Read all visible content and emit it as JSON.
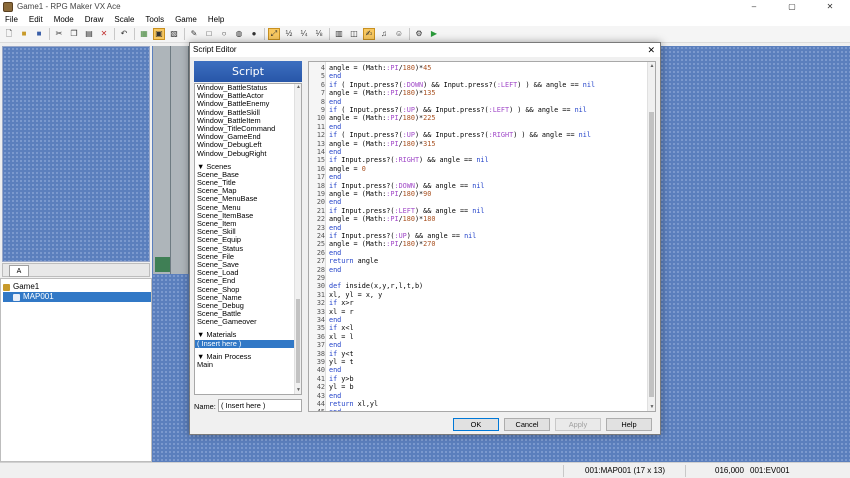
{
  "window": {
    "title": "Game1 - RPG Maker VX Ace",
    "minimize": "–",
    "maximize": "▢",
    "close": "✕"
  },
  "menu": [
    "File",
    "Edit",
    "Mode",
    "Draw",
    "Scale",
    "Tools",
    "Game",
    "Help"
  ],
  "toolbar": {
    "groupA": [
      "new-icon",
      "open-icon",
      "save-icon",
      "cut-icon",
      "copy-icon",
      "paste-icon",
      "delete-icon"
    ],
    "groupB": [
      "undo-icon"
    ],
    "groupC": [
      "map-layer-icon",
      "event-layer-icon",
      "region-icon"
    ],
    "groupD": [
      "pencil-icon",
      "rectangle-icon",
      "ellipse-icon",
      "fill-icon",
      "shadow-pen-icon"
    ],
    "groupE": [
      "scale-1-1-icon",
      "scale-1-2-icon",
      "scale-1-4-icon",
      "scale-1-8-icon"
    ],
    "groupF": [
      "database-icon",
      "resource-manager-icon",
      "script-editor-icon",
      "sound-test-icon",
      "character-generator-icon"
    ],
    "groupG": [
      "search-icon",
      "playtest-icon"
    ],
    "scale_labels": [
      "½",
      "¼",
      "⅛"
    ]
  },
  "tileset": {
    "tab": "A"
  },
  "map_tree": {
    "project": "Game1",
    "maps": [
      "MAP001"
    ],
    "selected": "MAP001"
  },
  "status": {
    "map": "001:MAP001 (17 x 13)",
    "coords": "016,000",
    "event": "001:EV001"
  },
  "dialog": {
    "title": "Script Editor",
    "close": "✕",
    "header": "Script",
    "list": [
      {
        "text": "Window_BattleStatus"
      },
      {
        "text": "Window_BattleActor"
      },
      {
        "text": "Window_BattleEnemy"
      },
      {
        "text": "Window_BattleSkill"
      },
      {
        "text": "Window_BattleItem"
      },
      {
        "text": "Window_TitleCommand"
      },
      {
        "text": "Window_GameEnd"
      },
      {
        "text": "Window_DebugLeft"
      },
      {
        "text": "Window_DebugRight"
      },
      {
        "gap": true
      },
      {
        "text": "▼ Scenes",
        "section": true
      },
      {
        "text": "Scene_Base"
      },
      {
        "text": "Scene_Title"
      },
      {
        "text": "Scene_Map"
      },
      {
        "text": "Scene_MenuBase"
      },
      {
        "text": "Scene_Menu"
      },
      {
        "text": "Scene_ItemBase"
      },
      {
        "text": "Scene_Item"
      },
      {
        "text": "Scene_Skill"
      },
      {
        "text": "Scene_Equip"
      },
      {
        "text": "Scene_Status"
      },
      {
        "text": "Scene_File"
      },
      {
        "text": "Scene_Save"
      },
      {
        "text": "Scene_Load"
      },
      {
        "text": "Scene_End"
      },
      {
        "text": "Scene_Shop"
      },
      {
        "text": "Scene_Name"
      },
      {
        "text": "Scene_Debug"
      },
      {
        "text": "Scene_Battle"
      },
      {
        "text": "Scene_Gameover"
      },
      {
        "gap": true
      },
      {
        "text": "▼ Materials",
        "section": true
      },
      {
        "text": "( Insert here )",
        "selected": true
      },
      {
        "gap": true
      },
      {
        "text": "▼ Main Process",
        "section": true
      },
      {
        "text": "Main"
      }
    ],
    "name_label": "Name:",
    "name_value": "( Insert here )",
    "code": [
      {
        "n": "4",
        "t": "angle = (Math::PI/180)*45"
      },
      {
        "n": "5",
        "t": "end"
      },
      {
        "n": "6",
        "t": "if ( Input.press?(:DOWN) && Input.press?(:LEFT) ) && angle == nil"
      },
      {
        "n": "7",
        "t": "angle = (Math::PI/180)*135"
      },
      {
        "n": "8",
        "t": "end"
      },
      {
        "n": "9",
        "t": "if ( Input.press?(:UP) && Input.press?(:LEFT) ) && angle == nil"
      },
      {
        "n": "10",
        "t": "angle = (Math::PI/180)*225"
      },
      {
        "n": "11",
        "t": "end"
      },
      {
        "n": "12",
        "t": "if ( Input.press?(:UP) && Input.press?(:RIGHT) ) && angle == nil"
      },
      {
        "n": "13",
        "t": "angle = (Math::PI/180)*315"
      },
      {
        "n": "14",
        "t": "end"
      },
      {
        "n": "15",
        "t": "if Input.press?(:RIGHT) && angle == nil"
      },
      {
        "n": "16",
        "t": "angle = 0"
      },
      {
        "n": "17",
        "t": "end"
      },
      {
        "n": "18",
        "t": "if Input.press?(:DOWN) && angle == nil"
      },
      {
        "n": "19",
        "t": "angle = (Math::PI/180)*90"
      },
      {
        "n": "20",
        "t": "end"
      },
      {
        "n": "21",
        "t": "if Input.press?(:LEFT) && angle == nil"
      },
      {
        "n": "22",
        "t": "angle = (Math::PI/180)*180"
      },
      {
        "n": "23",
        "t": "end"
      },
      {
        "n": "24",
        "t": "if Input.press?(:UP) && angle == nil"
      },
      {
        "n": "25",
        "t": "angle = (Math::PI/180)*270"
      },
      {
        "n": "26",
        "t": "end"
      },
      {
        "n": "27",
        "t": "return angle"
      },
      {
        "n": "28",
        "t": "end"
      },
      {
        "n": "29",
        "t": ""
      },
      {
        "n": "30",
        "t": "def inside(x,y,r,l,t,b)"
      },
      {
        "n": "31",
        "t": "xl, yl = x, y"
      },
      {
        "n": "32",
        "t": "if x>r"
      },
      {
        "n": "33",
        "t": "xl = r"
      },
      {
        "n": "34",
        "t": "end"
      },
      {
        "n": "35",
        "t": "if x<l"
      },
      {
        "n": "36",
        "t": "xl = l"
      },
      {
        "n": "37",
        "t": "end"
      },
      {
        "n": "38",
        "t": "if y<t"
      },
      {
        "n": "39",
        "t": "yl = t"
      },
      {
        "n": "40",
        "t": "end"
      },
      {
        "n": "41",
        "t": "if y>b"
      },
      {
        "n": "42",
        "t": "yl = b"
      },
      {
        "n": "43",
        "t": "end"
      },
      {
        "n": "44",
        "t": "return xl,yl"
      },
      {
        "n": "45",
        "t": "end"
      }
    ],
    "buttons": {
      "ok": "OK",
      "cancel": "Cancel",
      "apply": "Apply",
      "help": "Help"
    }
  }
}
